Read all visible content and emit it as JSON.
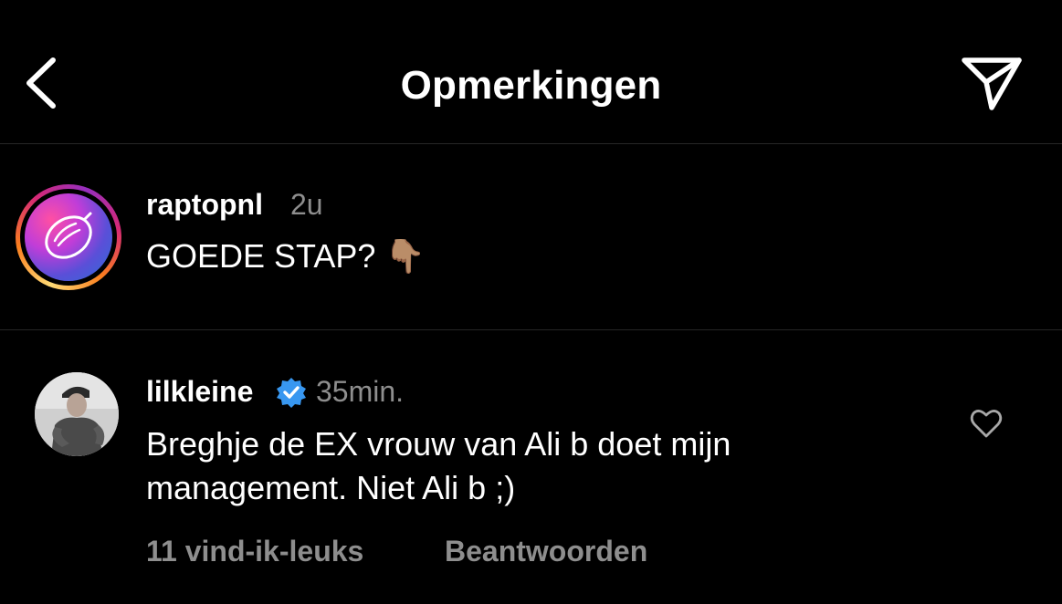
{
  "header": {
    "title": "Opmerkingen",
    "back_icon": "chevron-left-icon",
    "share_icon": "paper-plane-icon"
  },
  "caption": {
    "username": "raptopnl",
    "time": "2u",
    "text": "GOEDE STAP? 👇🏽"
  },
  "comment": {
    "username": "lilkleine",
    "verified": true,
    "time": "35min.",
    "text_line1": "Breghje de EX vrouw van Ali b doet mijn",
    "text_line2": "management. Niet Ali b ;)",
    "likes": "11 vind-ik-leuks",
    "reply_label": "Beantwoorden"
  },
  "colors": {
    "background": "#000000",
    "secondary_text": "#8e8e8e",
    "verified_blue": "#3897f0",
    "divider": "#262626"
  }
}
